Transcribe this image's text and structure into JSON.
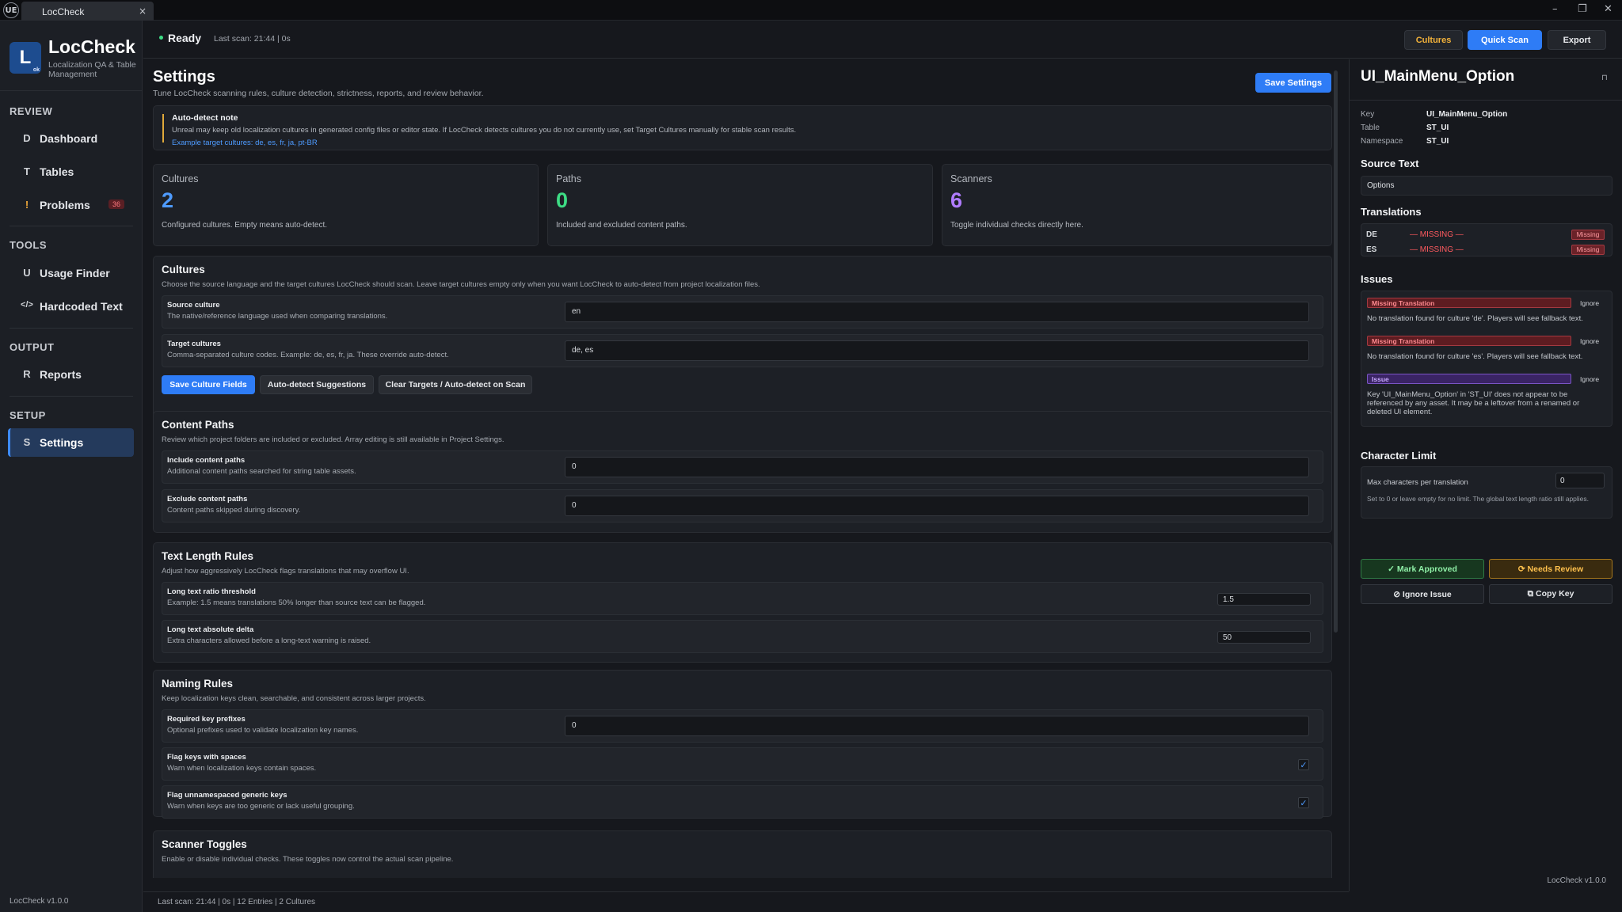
{
  "window": {
    "logo": "UE",
    "tab_title": "LocCheck",
    "tab_close": "×",
    "minimize": "–",
    "restore": "❐",
    "close": "✕"
  },
  "sidebar": {
    "logo_letter": "L",
    "logo_sub": "ok",
    "app_name": "LocCheck",
    "app_subtitle": "Localization QA & Table Management",
    "sections": [
      {
        "title": "REVIEW",
        "items": [
          {
            "icon": "D",
            "label": "Dashboard"
          },
          {
            "icon": "T",
            "label": "Tables"
          },
          {
            "icon": "!",
            "label": "Problems",
            "badge": "36"
          }
        ]
      },
      {
        "title": "TOOLS",
        "items": [
          {
            "icon": "U",
            "label": "Usage Finder"
          },
          {
            "icon": "</>",
            "label": "Hardcoded Text"
          }
        ]
      },
      {
        "title": "OUTPUT",
        "items": [
          {
            "icon": "R",
            "label": "Reports"
          }
        ]
      },
      {
        "title": "SETUP",
        "items": [
          {
            "icon": "S",
            "label": "Settings",
            "active": true
          }
        ]
      }
    ],
    "footer": "LocCheck v1.0.0"
  },
  "topbar": {
    "status": "Ready",
    "meta": "Last scan: 21:44  |  0s",
    "buttons": {
      "cultures": "Cultures",
      "quick_scan": "Quick Scan",
      "export": "Export"
    },
    "status_color": "#3ddc84"
  },
  "settings": {
    "title": "Settings",
    "subtitle": "Tune LocCheck scanning rules, culture detection, strictness, reports, and review behavior.",
    "save_button": "Save Settings",
    "note": {
      "title": "Auto-detect note",
      "body": "Unreal may keep old localization cultures in generated config files or editor state. If LocCheck detects cultures you do not currently use, set Target Cultures manually for stable scan results.",
      "link": "Example target cultures: de, es, fr, ja, pt-BR"
    },
    "stats": [
      {
        "label": "Cultures",
        "value": "2",
        "desc": "Configured cultures. Empty means auto-detect.",
        "color": "#4e9bff"
      },
      {
        "label": "Paths",
        "value": "0",
        "desc": "Included and excluded content paths.",
        "color": "#3ddc84"
      },
      {
        "label": "Scanners",
        "value": "6",
        "desc": "Toggle individual checks directly here.",
        "color": "#b07cff"
      }
    ],
    "cultures": {
      "title": "Cultures",
      "subtitle": "Choose the source language and the target cultures LocCheck should scan. Leave target cultures empty only when you want LocCheck to auto-detect from project localization files.",
      "source": {
        "label": "Source culture",
        "desc": "The native/reference language used when comparing translations.",
        "value": "en"
      },
      "target": {
        "label": "Target cultures",
        "desc": "Comma-separated culture codes. Example: de, es, fr, ja. These override auto-detect.",
        "value": "de, es"
      },
      "buttons": {
        "save": "Save Culture Fields",
        "suggest": "Auto-detect Suggestions",
        "clear": "Clear Targets / Auto-detect on Scan"
      }
    },
    "content_paths": {
      "title": "Content Paths",
      "subtitle": "Review which project folders are included or excluded. Array editing is still available in Project Settings.",
      "include": {
        "label": "Include content paths",
        "desc": "Additional content paths searched for string table assets.",
        "value": "0"
      },
      "exclude": {
        "label": "Exclude content paths",
        "desc": "Content paths skipped during discovery.",
        "value": "0"
      }
    },
    "text_length": {
      "title": "Text Length Rules",
      "subtitle": "Adjust how aggressively LocCheck flags translations that may overflow UI.",
      "ratio": {
        "label": "Long text ratio threshold",
        "desc": "Example: 1.5 means translations 50% longer than source text can be flagged.",
        "value": "1.5"
      },
      "delta": {
        "label": "Long text absolute delta",
        "desc": "Extra characters allowed before a long-text warning is raised.",
        "value": "50"
      }
    },
    "naming": {
      "title": "Naming Rules",
      "subtitle": "Keep localization keys clean, searchable, and consistent across larger projects.",
      "prefixes": {
        "label": "Required key prefixes",
        "desc": "Optional prefixes used to validate localization key names.",
        "value": "0"
      },
      "spaces": {
        "label": "Flag keys with spaces",
        "desc": "Warn when localization keys contain spaces.",
        "checked": "✓"
      },
      "generic": {
        "label": "Flag unnamespaced generic keys",
        "desc": "Warn when keys are too generic or lack useful grouping.",
        "checked": "✓"
      }
    },
    "scanner_toggles": {
      "title": "Scanner Toggles",
      "subtitle": "Enable or disable individual checks. These toggles now control the actual scan pipeline."
    }
  },
  "statusbar": "Last scan: 21:44  |  0s    | 12 Entries    | 2 Cultures",
  "detail": {
    "title": "UI_MainMenu_Option",
    "pin": "⊓",
    "key_label": "Key",
    "key": "UI_MainMenu_Option",
    "table_label": "Table",
    "table": "ST_UI",
    "namespace_label": "Namespace",
    "namespace": "ST_UI",
    "source_heading": "Source Text",
    "source_text": "Options",
    "translations_heading": "Translations",
    "translations": [
      {
        "code": "DE",
        "value": "— MISSING —",
        "tag": "Missing"
      },
      {
        "code": "ES",
        "value": "— MISSING —",
        "tag": "Missing"
      }
    ],
    "issues_heading": "Issues",
    "issues": [
      {
        "type": "Missing Translation",
        "ignore": "Ignore",
        "desc": "No translation found for culture 'de'. Players will see fallback text."
      },
      {
        "type": "Missing Translation",
        "ignore": "Ignore",
        "desc": "No translation found for culture 'es'. Players will see fallback text."
      },
      {
        "type": "Issue",
        "ignore": "Ignore",
        "desc": "Key 'UI_MainMenu_Option' in 'ST_UI' does not appear to be referenced by any asset. It may be a leftover from a renamed or deleted UI element."
      }
    ],
    "char_limit_heading": "Character Limit",
    "char_limit_label": "Max characters per translation",
    "char_limit_value": "0",
    "char_limit_note": "Set to 0 or leave empty for no limit. The global text length ratio still applies.",
    "actions": {
      "approve": "✓ Mark Approved",
      "review": "⟳ Needs Review",
      "ignore": "⊘ Ignore Issue",
      "copy": "⧉ Copy Key"
    },
    "footer": "LocCheck v1.0.0"
  }
}
